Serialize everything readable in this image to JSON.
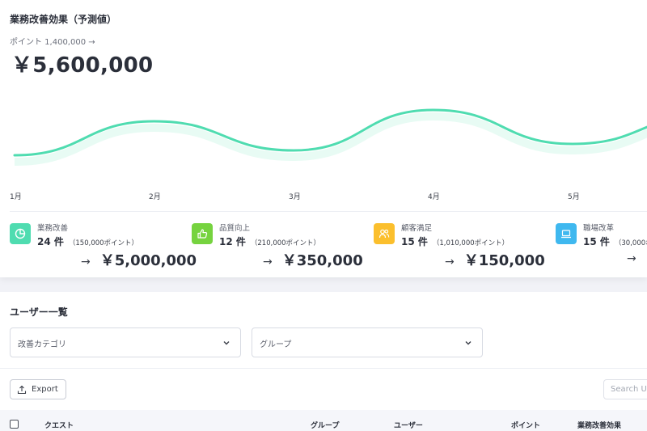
{
  "header": {
    "title": "業務改善効果（予測値）",
    "points_line": "ポイント 1,400,000 →",
    "total": "￥5,600,000"
  },
  "chart_data": {
    "type": "line",
    "categories": [
      "1月",
      "2月",
      "3月",
      "4月",
      "5月"
    ],
    "series": [
      {
        "values": [
          0.95,
          2.0,
          1.1,
          2.35,
          1.3
        ]
      }
    ],
    "line_color": "#4fdcb0",
    "band_color": "#e8fbf4"
  },
  "stats": [
    {
      "label": "業務改善",
      "count": "24 件",
      "points": "（150,000ポイント）",
      "arrow": "→",
      "amount": "￥5,000,000",
      "color": "#4fdcb0",
      "icon": "pie-chart-icon"
    },
    {
      "label": "品質向上",
      "count": "12 件",
      "points": "（210,000ポイント）",
      "arrow": "→",
      "amount": "￥350,000",
      "color": "#76d33f",
      "icon": "thumbs-up-icon"
    },
    {
      "label": "顧客満足",
      "count": "15 件",
      "points": "（1,010,000ポイント）",
      "arrow": "→",
      "amount": "￥150,000",
      "color": "#fbbf2d",
      "icon": "users-icon"
    },
    {
      "label": "職場改革",
      "count": "15 件",
      "points": "（30,000ポイ",
      "arrow": "→",
      "amount": "",
      "color": "#3fb8ef",
      "icon": "laptop-icon"
    }
  ],
  "users": {
    "title": "ユーザー一覧",
    "filter_category": "改善カテゴリ",
    "filter_group": "グループ",
    "export_label": "Export",
    "search_placeholder": "Search Us",
    "columns": [
      "クエスト",
      "グループ",
      "ユーザー",
      "ポイント",
      "業務改善効果"
    ]
  }
}
